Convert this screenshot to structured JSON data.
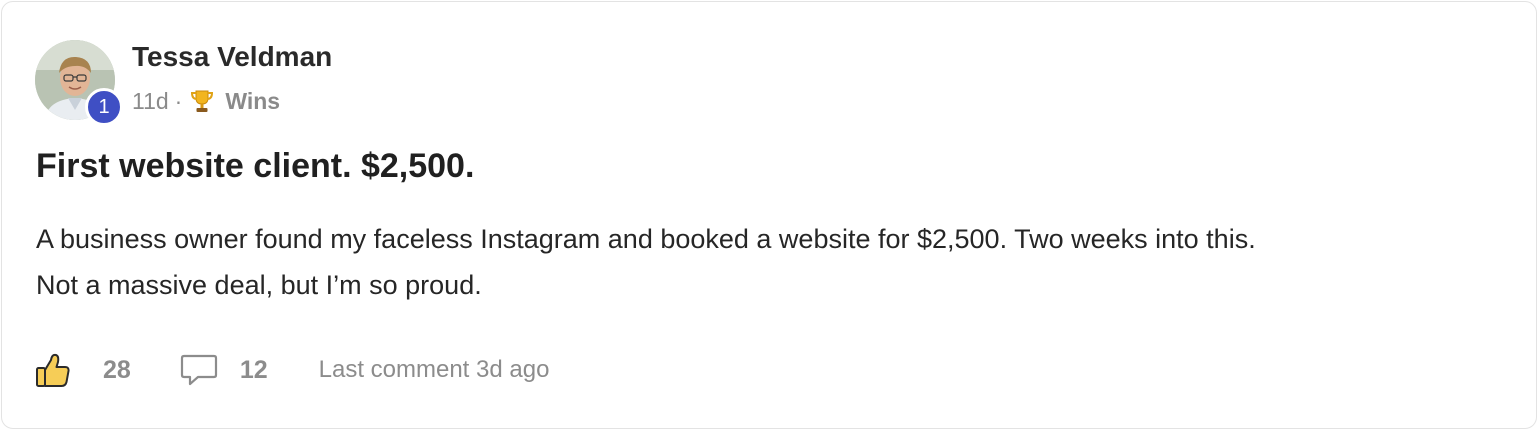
{
  "post": {
    "author": {
      "name": "Tessa Veldman",
      "level": "1"
    },
    "meta": {
      "age": "11d",
      "separator": "·",
      "category_icon": "trophy-icon",
      "category": "Wins"
    },
    "title": "First website client. $2,500.",
    "body": [
      "A business owner found my faceless Instagram and booked a website for $2,500. Two weeks into this.",
      "Not a massive deal, but I’m so proud."
    ],
    "actions": {
      "like_icon": "thumbs-up-icon",
      "likes": "28",
      "comment_icon": "comment-icon",
      "comments": "12",
      "last_comment": "Last comment 3d ago"
    }
  },
  "colors": {
    "badge": "#3f4fc4",
    "muted_text": "#8a8a8a",
    "border": "#e3e3e3"
  }
}
